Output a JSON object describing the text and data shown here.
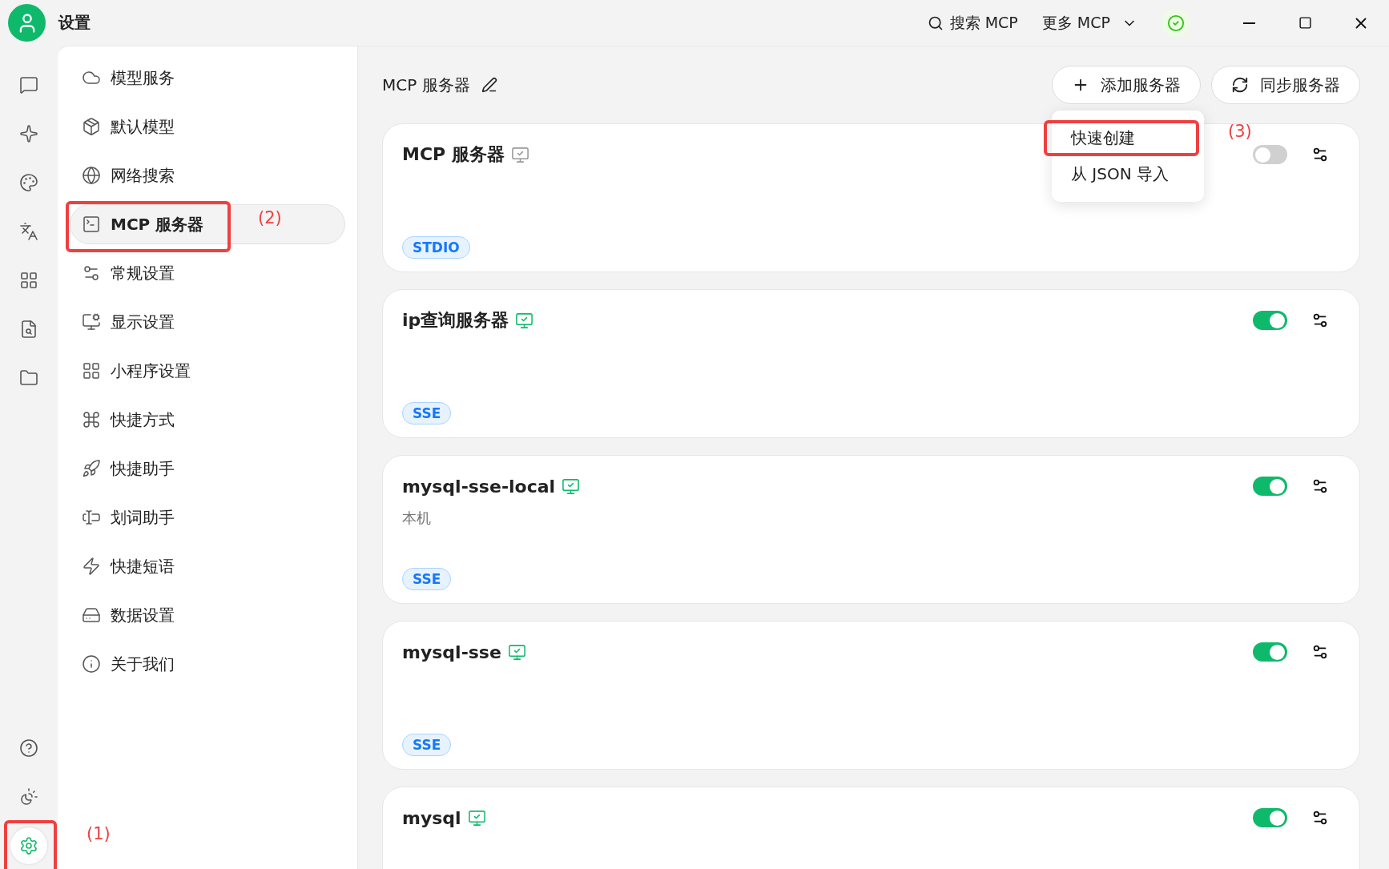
{
  "window": {
    "title": "设置",
    "actions": [
      {
        "kind": "search",
        "label": "搜索 MCP"
      },
      {
        "kind": "dropdown",
        "label": "更多 MCP"
      },
      {
        "kind": "status"
      }
    ]
  },
  "rail": {
    "top": [
      {
        "selected": false
      },
      {
        "selected": false
      },
      {
        "selected": false
      },
      {
        "selected": false
      },
      {
        "selected": false
      },
      {
        "selected": false
      },
      {
        "selected": false
      }
    ],
    "bottom": [
      {
        "selected": false
      },
      {
        "selected": false
      },
      {
        "selected": true,
        "annotation": "(1)"
      }
    ]
  },
  "sidebar": {
    "items": [
      {
        "label": "模型服务",
        "selected": false
      },
      {
        "label": "默认模型",
        "selected": false
      },
      {
        "label": "网络搜索",
        "selected": false
      },
      {
        "label": "MCP 服务器",
        "selected": true,
        "annotation": "(2)"
      },
      {
        "label": "常规设置",
        "selected": false
      },
      {
        "label": "显示设置",
        "selected": false
      },
      {
        "label": "小程序设置",
        "selected": false
      },
      {
        "label": "快捷方式",
        "selected": false
      },
      {
        "label": "快捷助手",
        "selected": false
      },
      {
        "label": "划词助手",
        "selected": false
      },
      {
        "label": "快捷短语",
        "selected": false
      },
      {
        "label": "数据设置",
        "selected": false
      },
      {
        "label": "关于我们",
        "selected": false
      }
    ]
  },
  "header": {
    "title": "MCP 服务器",
    "buttons": [
      {
        "kind": "add",
        "label": "添加服务器"
      },
      {
        "kind": "sync",
        "label": "同步服务器"
      }
    ]
  },
  "dropdown": {
    "items": [
      {
        "label": "快速创建",
        "annotation": "(3)"
      },
      {
        "label": "从 JSON 导入"
      }
    ]
  },
  "servers": [
    {
      "name": "MCP 服务器",
      "active": false,
      "tag": "STDIO",
      "enabled": false
    },
    {
      "name": "ip查询服务器",
      "active": true,
      "tag": "SSE",
      "enabled": true
    },
    {
      "name": "mysql-sse-local",
      "active": true,
      "description": "本机",
      "tag": "SSE",
      "enabled": true
    },
    {
      "name": "mysql-sse",
      "active": true,
      "tag": "SSE",
      "enabled": true
    },
    {
      "name": "mysql",
      "active": true,
      "enabled": true
    }
  ]
}
